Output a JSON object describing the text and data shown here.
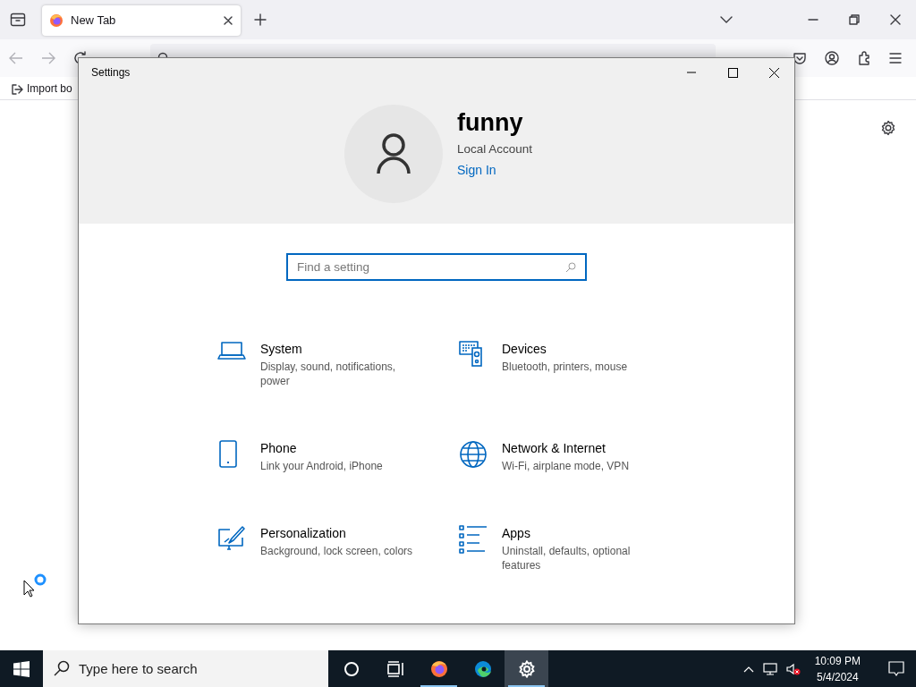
{
  "browser": {
    "tabs": [
      {
        "title": "New Tab",
        "selected": true
      }
    ],
    "bookmarks": [
      {
        "label": "Import bo"
      }
    ]
  },
  "settings_window": {
    "title": "Settings",
    "account": {
      "name": "funny",
      "type": "Local Account",
      "link": "Sign In"
    },
    "search": {
      "placeholder": "Find a setting"
    },
    "categories": [
      {
        "kind": "laptop",
        "name": "System",
        "description": "Display, sound, notifications, power"
      },
      {
        "kind": "devices",
        "name": "Devices",
        "description": "Bluetooth, printers, mouse"
      },
      {
        "kind": "phone",
        "name": "Phone",
        "description": "Link your Android, iPhone"
      },
      {
        "kind": "globe",
        "name": "Network & Internet",
        "description": "Wi-Fi, airplane mode, VPN"
      },
      {
        "kind": "paint",
        "name": "Personalization",
        "description": "Background, lock screen, colors"
      },
      {
        "kind": "list",
        "name": "Apps",
        "description": "Uninstall, defaults, optional features"
      }
    ]
  },
  "taskbar": {
    "search": {
      "placeholder": "Type here to search"
    },
    "apps": [
      {
        "kind": "cortana",
        "running": false,
        "selected": false
      },
      {
        "kind": "taskview",
        "running": false,
        "selected": false
      },
      {
        "kind": "firefox",
        "running": true,
        "selected": false
      },
      {
        "kind": "edge",
        "running": false,
        "selected": false
      },
      {
        "kind": "settings",
        "running": true,
        "selected": true
      }
    ],
    "time": "10:09 PM",
    "date": "5/4/2024"
  }
}
